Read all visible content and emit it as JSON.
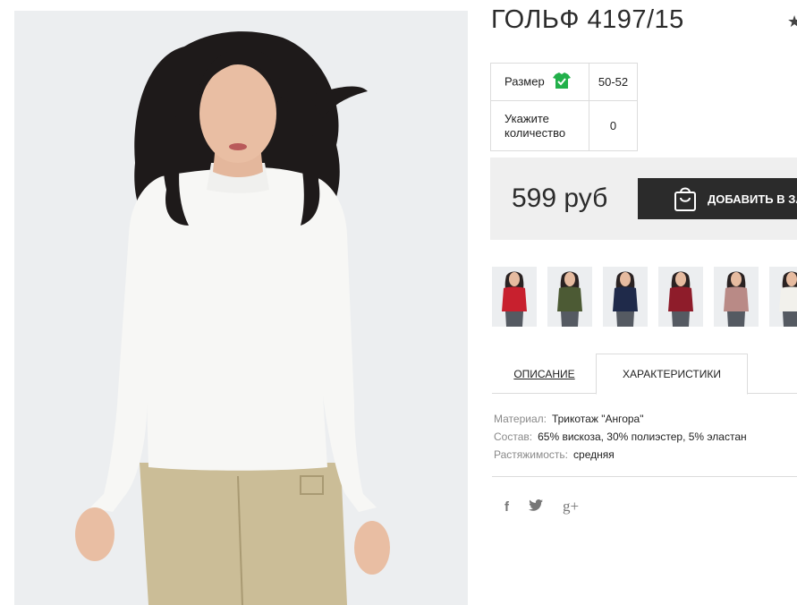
{
  "product": {
    "title": "ГОЛЬФ 4197/15",
    "price": "599 руб",
    "cart_button_label": "ДОБАВИТЬ В ЗА"
  },
  "options": {
    "size_label": "Размер",
    "size_value": "50-52",
    "quantity_label_line1": "Укажите",
    "quantity_label_line2": "количество",
    "quantity_value": "0"
  },
  "thumbnails": [
    {
      "color": "#c8202e",
      "name": "red"
    },
    {
      "color": "#4c5a34",
      "name": "olive"
    },
    {
      "color": "#1f2a4a",
      "name": "navy"
    },
    {
      "color": "#8e1c2a",
      "name": "burgundy"
    },
    {
      "color": "#b98a86",
      "name": "dusty-pink"
    },
    {
      "color": "#f2f1ec",
      "name": "white"
    }
  ],
  "tabs": {
    "description": "ОПИСАНИЕ",
    "characteristics": "ХАРАКТЕРИСТИКИ"
  },
  "specs": [
    {
      "key": "Материал:",
      "value": "Трикотаж \"Ангора\""
    },
    {
      "key": "Состав:",
      "value": "65% вискоза, 30% полиэстер, 5% эластан"
    },
    {
      "key": "Растяжимость:",
      "value": "средняя"
    }
  ],
  "social": {
    "facebook": "f",
    "twitter": "twitter-icon",
    "googleplus": "g+"
  },
  "colors": {
    "accent_dark": "#2b2b2b",
    "price_bg": "#efefef",
    "check_green": "#22b04a"
  }
}
